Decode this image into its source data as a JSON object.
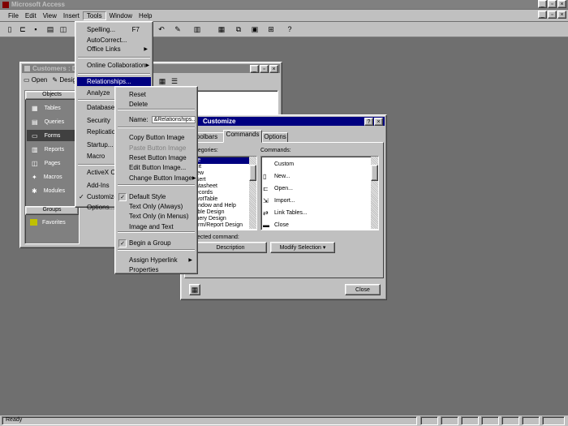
{
  "app": {
    "title": "Microsoft Access",
    "status": "Ready"
  },
  "menubar": {
    "items": [
      "File",
      "Edit",
      "View",
      "Insert",
      "Tools",
      "Window",
      "Help"
    ]
  },
  "db_window": {
    "title": "Customers : Da",
    "toolbar": [
      "Open",
      "Design"
    ],
    "groups_label": "Objects",
    "objects": [
      "Tables",
      "Queries",
      "Forms",
      "Reports",
      "Pages",
      "Macros",
      "Modules"
    ],
    "groups": "Groups",
    "favorites": "Favorites"
  },
  "tools_menu": {
    "items": [
      {
        "label": "Spelling...",
        "shortcut": "F7"
      },
      {
        "label": "AutoCorrect..."
      },
      {
        "label": "Office Links",
        "submenu": true
      },
      {
        "label": "Online Collaboration",
        "submenu": true
      },
      {
        "label": "Relationships..."
      },
      {
        "label": "Analyze",
        "submenu": true
      },
      {
        "label": "Database Utilities",
        "submenu": true
      },
      {
        "label": "Security",
        "submenu": true
      },
      {
        "label": "Replication",
        "submenu": true
      },
      {
        "label": "Startup..."
      },
      {
        "label": "Macro",
        "submenu": true
      },
      {
        "label": "ActiveX Controls..."
      },
      {
        "label": "Add-Ins",
        "submenu": true
      },
      {
        "label": "Customize..."
      },
      {
        "label": "Options..."
      }
    ],
    "visible_labels": [
      "Spelling...",
      "F7",
      "AutoCorrect...",
      "Office Links",
      "Online Collaboration",
      "Relationships...",
      "Analyze",
      "Databa",
      "Security",
      "Replicatio",
      "Startup",
      "Macro",
      "ActiveX Co",
      "Add-Ins",
      "Customize",
      "Options..."
    ]
  },
  "context_menu": {
    "items": [
      "Reset",
      "Delete",
      "Name:",
      "Copy Button Image",
      "Paste Button Image",
      "Reset Button Image",
      "Edit Button Image...",
      "Change Button Image",
      "Default Style",
      "Text Only (Always)",
      "Text Only (in Menus)",
      "Image and Text",
      "Begin a Group",
      "Assign Hyperlink",
      "Properties"
    ],
    "name_value": "&Relationships..."
  },
  "customize_dialog": {
    "title": "Customize",
    "tabs": [
      "Toolbars",
      "Commands",
      "Options"
    ],
    "categories_label": "Categories:",
    "categories": [
      "File",
      "Edit",
      "View",
      "Insert",
      "Datasheet",
      "Records",
      "PivotTable",
      "Window and Help",
      "Table Design",
      "Query Design",
      "Form/Report Design"
    ],
    "commands_label": "Commands:",
    "commands": [
      "Custom",
      "New...",
      "Open...",
      "Import...",
      "Link Tables...",
      "Close"
    ],
    "selected_label": "Selected command:",
    "description_btn": "Description",
    "modify_btn": "Modify Selection",
    "close_btn": "Close"
  }
}
